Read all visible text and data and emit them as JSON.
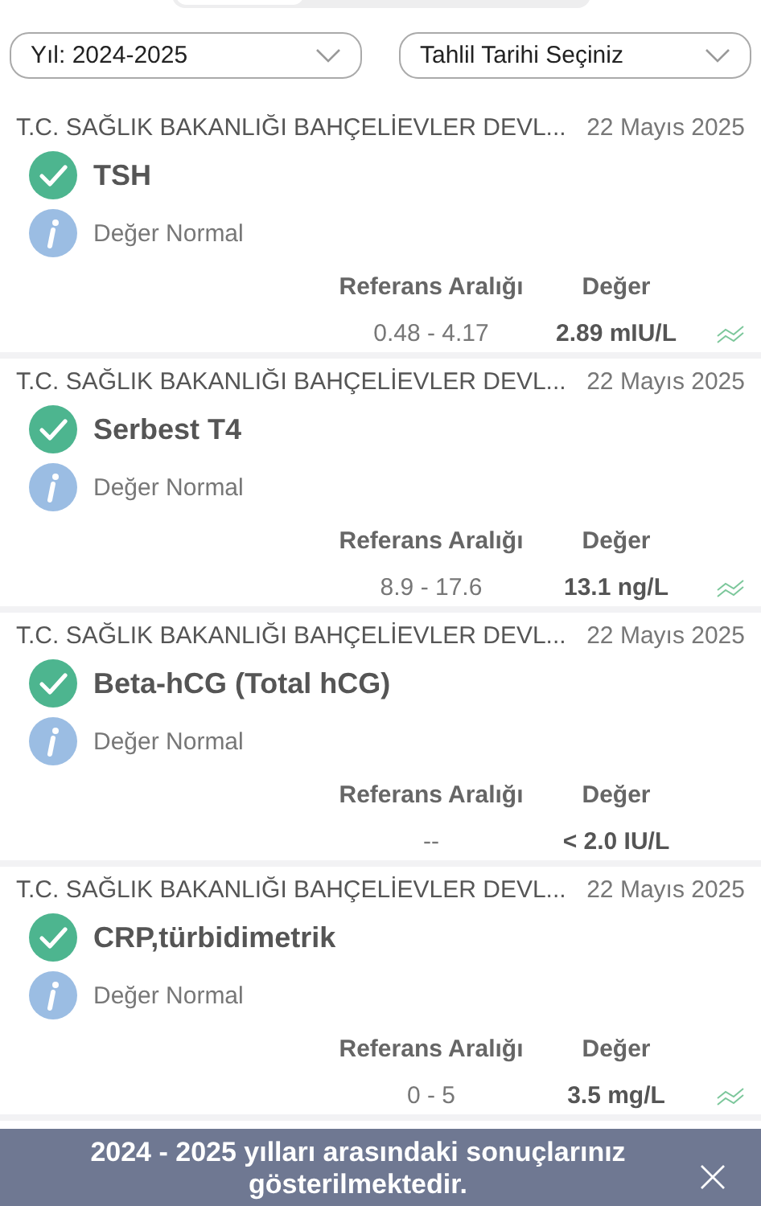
{
  "segments": [
    {
      "selected": true
    },
    {
      "selected": false
    }
  ],
  "filters": [
    {
      "label": "Yıl: 2024-2025"
    },
    {
      "label": "Tahlil Tarihi Seçiniz"
    }
  ],
  "results": [
    {
      "source": "T.C. SAĞLIK BAKANLIĞI BAHÇELİEVLER DEVL...",
      "date": "22 Mayıs 2025",
      "test": "TSH",
      "status": "Değer Normal",
      "range_label": "Referans Aralığı",
      "value_label": "Değer",
      "range": "0.48 - 4.17",
      "value": "2.89 mIU/L",
      "trend": true
    },
    {
      "source": "T.C. SAĞLIK BAKANLIĞI BAHÇELİEVLER DEVL...",
      "date": "22 Mayıs 2025",
      "test": "Serbest T4",
      "status": "Değer Normal",
      "range_label": "Referans Aralığı",
      "value_label": "Değer",
      "range": "8.9 - 17.6",
      "value": "13.1 ng/L",
      "trend": true
    },
    {
      "source": "T.C. SAĞLIK BAKANLIĞI BAHÇELİEVLER DEVL...",
      "date": "22 Mayıs 2025",
      "test": "Beta-hCG (Total hCG)",
      "status": "Değer Normal",
      "range_label": "Referans Aralığı",
      "value_label": "Değer",
      "range": "--",
      "value": "< 2.0 IU/L",
      "trend": false
    },
    {
      "source": "T.C. SAĞLIK BAKANLIĞI BAHÇELİEVLER DEVL...",
      "date": "22 Mayıs 2025",
      "test": "CRP,türbidimetrik",
      "status": "Değer Normal",
      "range_label": "Referans Aralığı",
      "value_label": "Değer",
      "range": "0 - 5",
      "value": "3.5 mg/L",
      "trend": true
    }
  ],
  "toast": {
    "message": "2024 - 2025 yılları arasındaki sonuçlarınız gösterilmektedir."
  }
}
